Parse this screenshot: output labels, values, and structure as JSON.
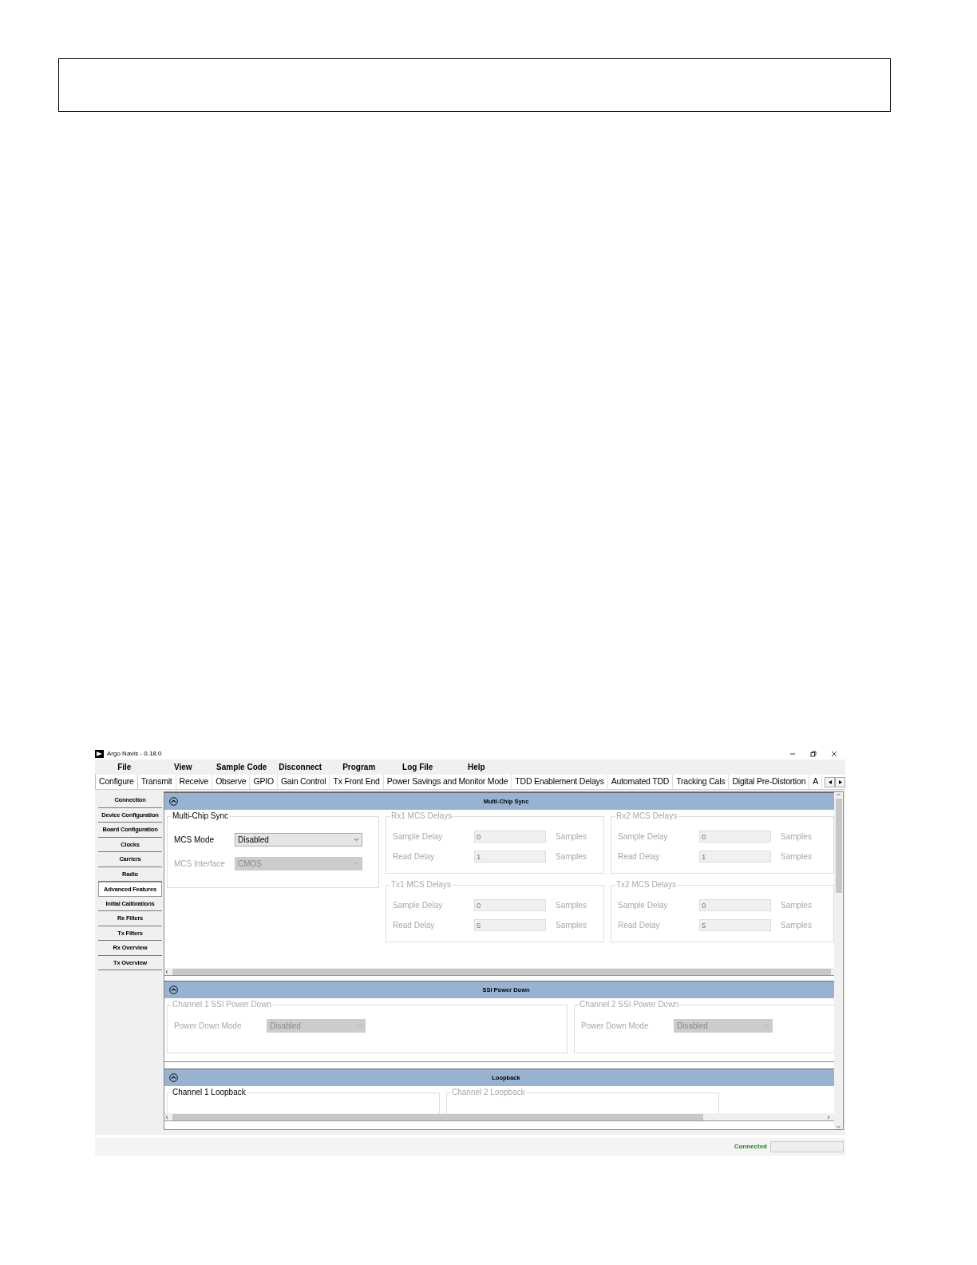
{
  "window": {
    "title": "Argo Navis - 0.18.0"
  },
  "menu": [
    "File",
    "View",
    "Sample Code",
    "Disconnect",
    "Program",
    "Log File",
    "Help"
  ],
  "tabs": [
    {
      "label": "Configure",
      "selected": true
    },
    {
      "label": "Transmit",
      "selected": false
    },
    {
      "label": "Receive",
      "selected": false
    },
    {
      "label": "Observe",
      "selected": false
    },
    {
      "label": "GPIO",
      "selected": false
    },
    {
      "label": "Gain Control",
      "selected": false
    },
    {
      "label": "Tx Front End",
      "selected": false
    },
    {
      "label": "Power Savings and Monitor Mode",
      "selected": false
    },
    {
      "label": "TDD Enablement Delays",
      "selected": false
    },
    {
      "label": "Automated TDD",
      "selected": false
    },
    {
      "label": "Tracking Cals",
      "selected": false
    },
    {
      "label": "Digital Pre-Distortion",
      "selected": false
    },
    {
      "label": "A",
      "selected": false
    }
  ],
  "sidebar": {
    "items": [
      {
        "label": "Connection",
        "selected": false
      },
      {
        "label": "Device Configuration",
        "selected": false
      },
      {
        "label": "Board Configuration",
        "selected": false
      },
      {
        "label": "Clocks",
        "selected": false
      },
      {
        "label": "Carriers",
        "selected": false
      },
      {
        "label": "Radio",
        "selected": false
      },
      {
        "label": "Advanced Features",
        "selected": true
      },
      {
        "label": "Initial Calibrations",
        "selected": false
      },
      {
        "label": "Rx Filters",
        "selected": false
      },
      {
        "label": "Tx Filters",
        "selected": false
      },
      {
        "label": "Rx Overview",
        "selected": false
      },
      {
        "label": "Tx Overview",
        "selected": false
      }
    ]
  },
  "sections": [
    {
      "title": "Multi-Chip Sync",
      "expanded": true,
      "kind": "mcs",
      "columns": [
        [
          {
            "title": "Multi-Chip Sync",
            "disabled": false,
            "fields": [
              {
                "kind": "dropdown",
                "label": "MCS Mode",
                "value": "Disabled",
                "disabled": false
              },
              {
                "kind": "dropdown",
                "label": "MCS Interface",
                "value": "CMOS",
                "disabled": true
              }
            ]
          }
        ],
        [
          {
            "title": "Rx1 MCS Delays",
            "disabled": true,
            "fields": [
              {
                "kind": "number",
                "label": "Sample Delay",
                "value": "0",
                "unit": "Samples",
                "disabled": true
              },
              {
                "kind": "number",
                "label": "Read Delay",
                "value": "1",
                "unit": "Samples",
                "disabled": true
              }
            ]
          },
          {
            "title": "Tx1 MCS Delays",
            "disabled": true,
            "fields": [
              {
                "kind": "number",
                "label": "Sample Delay",
                "value": "0",
                "unit": "Samples",
                "disabled": true
              },
              {
                "kind": "number",
                "label": "Read Delay",
                "value": "5",
                "unit": "Samples",
                "disabled": true
              }
            ]
          }
        ],
        [
          {
            "title": "Rx2 MCS Delays",
            "disabled": true,
            "fields": [
              {
                "kind": "number",
                "label": "Sample Delay",
                "value": "0",
                "unit": "Samples",
                "disabled": true
              },
              {
                "kind": "number",
                "label": "Read Delay",
                "value": "1",
                "unit": "Samples",
                "disabled": true
              }
            ]
          },
          {
            "title": "Tx2 MCS Delays",
            "disabled": true,
            "fields": [
              {
                "kind": "number",
                "label": "Sample Delay",
                "value": "0",
                "unit": "Samples",
                "disabled": true
              },
              {
                "kind": "number",
                "label": "Read Delay",
                "value": "5",
                "unit": "Samples",
                "disabled": true
              }
            ]
          }
        ]
      ]
    },
    {
      "title": "SSI Power Down",
      "expanded": true,
      "kind": "ssi",
      "columns": [
        [
          {
            "title": "Channel 1 SSI Power Down",
            "disabled": true,
            "fields": [
              {
                "kind": "dropdown",
                "label": "Power Down Mode",
                "value": "Disabled",
                "disabled": true
              }
            ]
          }
        ],
        [
          {
            "title": "Channel 2 SSI Power Down",
            "disabled": true,
            "fields": [
              {
                "kind": "dropdown",
                "label": "Power Down Mode",
                "value": "Disabled",
                "disabled": true
              }
            ]
          }
        ]
      ]
    },
    {
      "title": "Loopback",
      "expanded": true,
      "kind": "loop",
      "columns": [
        [
          {
            "title": "Channel 1 Loopback",
            "disabled": false
          }
        ],
        [
          {
            "title": "Channel 2 Loopback",
            "disabled": true
          }
        ]
      ]
    }
  ],
  "status_bar": {
    "text": "Connected"
  }
}
